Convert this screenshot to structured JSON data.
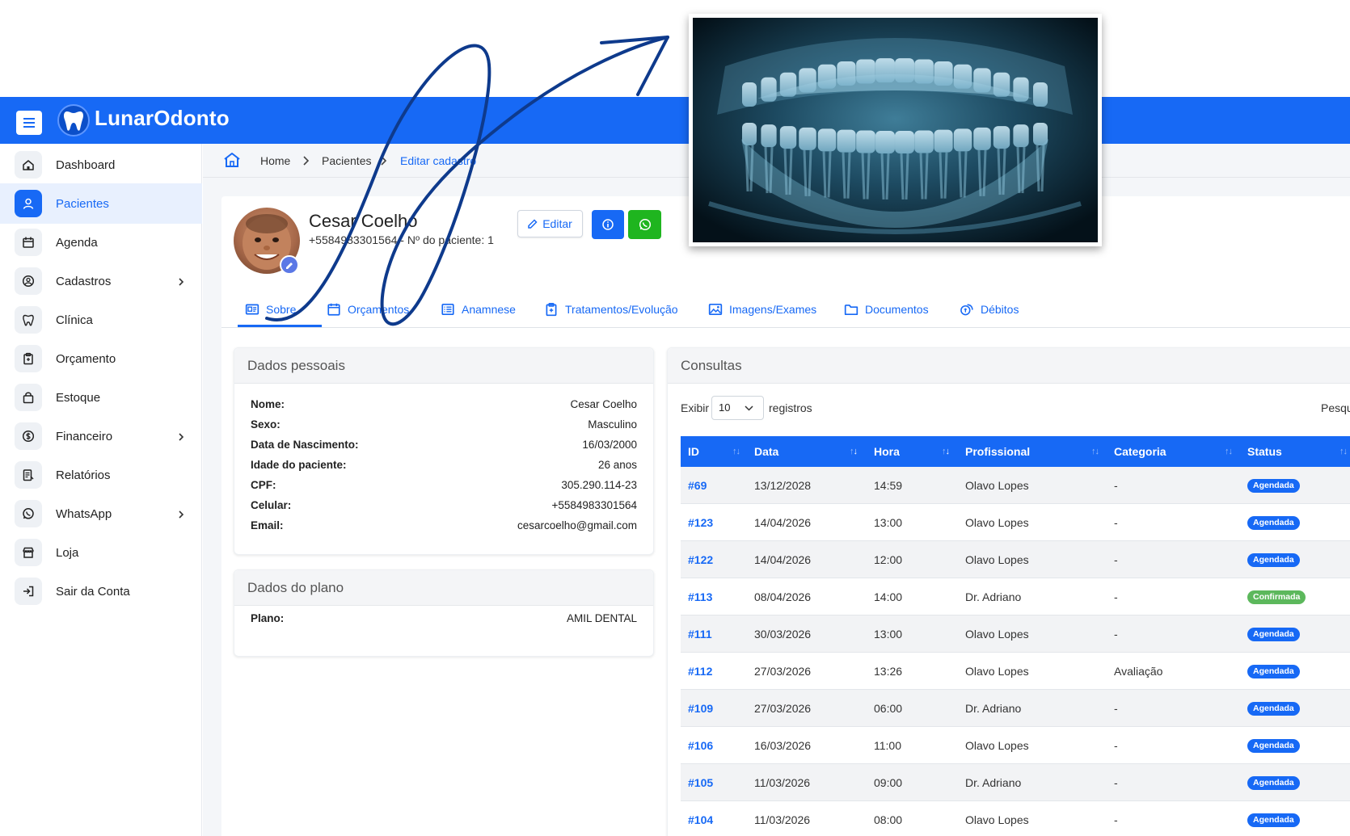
{
  "app": {
    "name": "LunarOdonto",
    "brand_color": "#1769f5"
  },
  "sidebar": {
    "items": [
      {
        "label": "Dashboard",
        "icon": "home-icon",
        "active": false,
        "expandable": false
      },
      {
        "label": "Pacientes",
        "icon": "user-icon",
        "active": true,
        "expandable": false
      },
      {
        "label": "Agenda",
        "icon": "calendar-icon",
        "active": false,
        "expandable": false
      },
      {
        "label": "Cadastros",
        "icon": "user-circle-icon",
        "active": false,
        "expandable": true
      },
      {
        "label": "Clínica",
        "icon": "tooth-icon",
        "active": false,
        "expandable": false
      },
      {
        "label": "Orçamento",
        "icon": "clipboard-icon",
        "active": false,
        "expandable": false
      },
      {
        "label": "Estoque",
        "icon": "bag-icon",
        "active": false,
        "expandable": false
      },
      {
        "label": "Financeiro",
        "icon": "dollar-icon",
        "active": false,
        "expandable": true
      },
      {
        "label": "Relatórios",
        "icon": "report-icon",
        "active": false,
        "expandable": false
      },
      {
        "label": "WhatsApp",
        "icon": "whatsapp-icon",
        "active": false,
        "expandable": true
      },
      {
        "label": "Loja",
        "icon": "store-icon",
        "active": false,
        "expandable": false
      },
      {
        "label": "Sair da Conta",
        "icon": "logout-icon",
        "active": false,
        "expandable": false
      }
    ]
  },
  "breadcrumb": {
    "home": "Home",
    "section": "Pacientes",
    "current": "Editar cadastro"
  },
  "patient": {
    "name": "Cesar Coelho",
    "subtitle": "+5584983301564 - Nº do paciente: 1"
  },
  "actions": {
    "edit_label": "Editar"
  },
  "tabs": [
    {
      "label": "Sobre",
      "icon": "id-card-icon",
      "active": true
    },
    {
      "label": "Orçamentos",
      "icon": "budget-icon",
      "active": false
    },
    {
      "label": "Anamnese",
      "icon": "list-icon",
      "active": false
    },
    {
      "label": "Tratamentos/Evolução",
      "icon": "clipboard-icon",
      "active": false
    },
    {
      "label": "Imagens/Exames",
      "icon": "image-icon",
      "active": false
    },
    {
      "label": "Documentos",
      "icon": "folder-icon",
      "active": false
    },
    {
      "label": "Débitos",
      "icon": "coins-icon",
      "active": false
    }
  ],
  "dados_pessoais": {
    "title": "Dados pessoais",
    "rows": [
      {
        "key": "Nome:",
        "value": "Cesar Coelho"
      },
      {
        "key": "Sexo:",
        "value": "Masculino"
      },
      {
        "key": "Data de Nascimento:",
        "value": "16/03/2000"
      },
      {
        "key": "Idade do paciente:",
        "value": "26 anos"
      },
      {
        "key": "CPF:",
        "value": "305.290.114-23"
      },
      {
        "key": "Celular:",
        "value": "+5584983301564"
      },
      {
        "key": "Email:",
        "value": "cesarcoelho@gmail.com"
      }
    ]
  },
  "dados_plano": {
    "title": "Dados do plano",
    "rows": [
      {
        "key": "Plano:",
        "value": "AMIL DENTAL"
      }
    ]
  },
  "consultas": {
    "title": "Consultas",
    "show_label": "Exibir",
    "page_size": "10",
    "records_label": "registros",
    "search_label": "Pesquisar:",
    "columns": [
      "ID",
      "Data",
      "Hora",
      "Profissional",
      "Categoria",
      "Status"
    ],
    "rows": [
      {
        "id": "#69",
        "data": "13/12/2028",
        "hora": "14:59",
        "profissional": "Olavo Lopes",
        "categoria": "-",
        "status": "Agendada"
      },
      {
        "id": "#123",
        "data": "14/04/2026",
        "hora": "13:00",
        "profissional": "Olavo Lopes",
        "categoria": "-",
        "status": "Agendada"
      },
      {
        "id": "#122",
        "data": "14/04/2026",
        "hora": "12:00",
        "profissional": "Olavo Lopes",
        "categoria": "-",
        "status": "Agendada"
      },
      {
        "id": "#113",
        "data": "08/04/2026",
        "hora": "14:00",
        "profissional": "Dr. Adriano",
        "categoria": "-",
        "status": "Confirmada"
      },
      {
        "id": "#111",
        "data": "30/03/2026",
        "hora": "13:00",
        "profissional": "Olavo Lopes",
        "categoria": "-",
        "status": "Agendada"
      },
      {
        "id": "#112",
        "data": "27/03/2026",
        "hora": "13:26",
        "profissional": "Olavo Lopes",
        "categoria": "Avaliação",
        "status": "Agendada"
      },
      {
        "id": "#109",
        "data": "27/03/2026",
        "hora": "06:00",
        "profissional": "Dr. Adriano",
        "categoria": "-",
        "status": "Agendada"
      },
      {
        "id": "#106",
        "data": "16/03/2026",
        "hora": "11:00",
        "profissional": "Olavo Lopes",
        "categoria": "-",
        "status": "Agendada"
      },
      {
        "id": "#105",
        "data": "11/03/2026",
        "hora": "09:00",
        "profissional": "Dr. Adriano",
        "categoria": "-",
        "status": "Agendada"
      },
      {
        "id": "#104",
        "data": "11/03/2026",
        "hora": "08:00",
        "profissional": "Olavo Lopes",
        "categoria": "-",
        "status": "Agendada"
      }
    ],
    "status_colors": {
      "Agendada": "#1769f5",
      "Confirmada": "#5cb85c"
    }
  }
}
